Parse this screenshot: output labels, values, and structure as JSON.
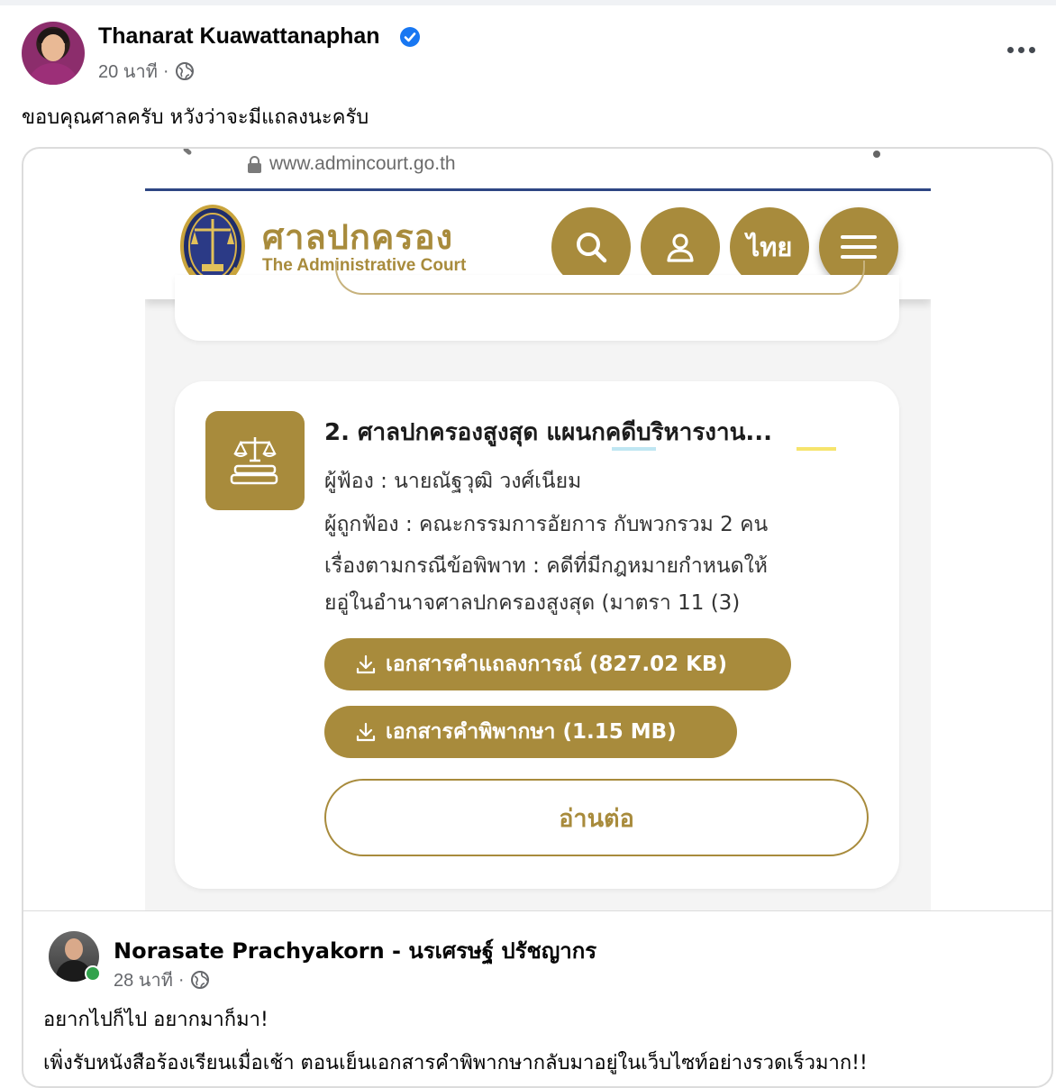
{
  "post": {
    "author": "Thanarat Kuawattanaphan",
    "time": "20 นาที",
    "separator": "·",
    "caption": "ขอบคุณศาลครับ หวังว่าจะมีแถลงนะครับ"
  },
  "embedded": {
    "url": "www.admincourt.go.th",
    "court_name_th": "ศาลปกครอง",
    "court_name_en": "The Administrative Court",
    "lang_button": "ไทย",
    "case": {
      "title": "2. ศาลปกครองสูงสุด แผนกคดีบริหารงาน...",
      "plaintiff": "ผู้ฟ้อง : นายณัฐวุฒิ วงศ์เนียม",
      "defendant": "ผู้ถูกฟ้อง : คณะกรรมการอัยการ กับพวกรวม 2 คน",
      "subject_line1": "เรื่องตามกรณีข้อพิพาท : คดีที่มีกฎหมายกำหนดให้",
      "subject_line2": "ยอู่ในอำนาจศาลปกครองสูงสุด (มาตรา 11 (3)",
      "doc_statement": "เอกสารคำแถลงการณ์ (827.02 KB)",
      "doc_judgment": "เอกสารคำพิพากษา (1.15 MB)",
      "read_more": "อ่านต่อ"
    }
  },
  "shared": {
    "author": "Norasate Prachyakorn - นรเศรษฐ์ ปรัชญากร",
    "time": "28 นาที",
    "separator": "·",
    "line1": "อยากไปก็ไป อยากมาก็มา!",
    "line2": "เพิ่งรับหนังสือร้องเรียนเมื่อเช้า ตอนเย็นเอกสารคำพิพากษากลับมาอยู่ในเว็บไซท์อย่างรวดเร็วมาก!!"
  },
  "colors": {
    "court_gold": "#a88b3c",
    "court_blue_rule": "#2e4784",
    "verified_blue": "#1877f2",
    "online_green": "#31a24c"
  }
}
